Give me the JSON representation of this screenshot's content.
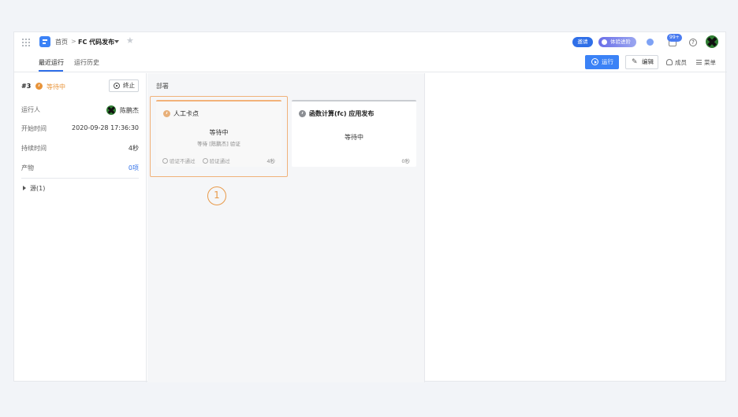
{
  "header": {
    "breadcrumb_home": "首页",
    "breadcrumb_sep": ">",
    "pipeline_name": "FC 代码发布",
    "invite_label": "邀请",
    "try_label": "体验进阶",
    "notification_badge": "99+"
  },
  "tabs": {
    "recent": "最近运行",
    "history": "运行历史"
  },
  "toolbar": {
    "run_label": "运行",
    "edit_label": "编辑",
    "members_label": "成员",
    "menu_label": "菜单"
  },
  "run": {
    "number": "#3",
    "status": "等待中",
    "stop_label": "终止",
    "details": [
      {
        "label": "运行人",
        "value": "陈鹏杰"
      },
      {
        "label": "开始时间",
        "value": "2020-09-28 17:36:30"
      },
      {
        "label": "持续时间",
        "value": "4秒"
      },
      {
        "label": "产物",
        "value": "0项"
      }
    ],
    "source_label": "源(1)"
  },
  "stage": {
    "title": "部署",
    "jobs": [
      {
        "name": "人工卡点",
        "state": "等待中",
        "sub": "等待 [陈鹏杰] 验证",
        "action_reject": "验证不通过",
        "action_approve": "验证通过",
        "duration": "4秒"
      },
      {
        "name": "函数计算(fc) 应用发布",
        "state": "等待中",
        "duration": "0秒"
      }
    ],
    "callout": "1"
  },
  "colors": {
    "primary": "#3b82f6",
    "waiting": "#e8943a",
    "highlight": "#f0b27a"
  }
}
